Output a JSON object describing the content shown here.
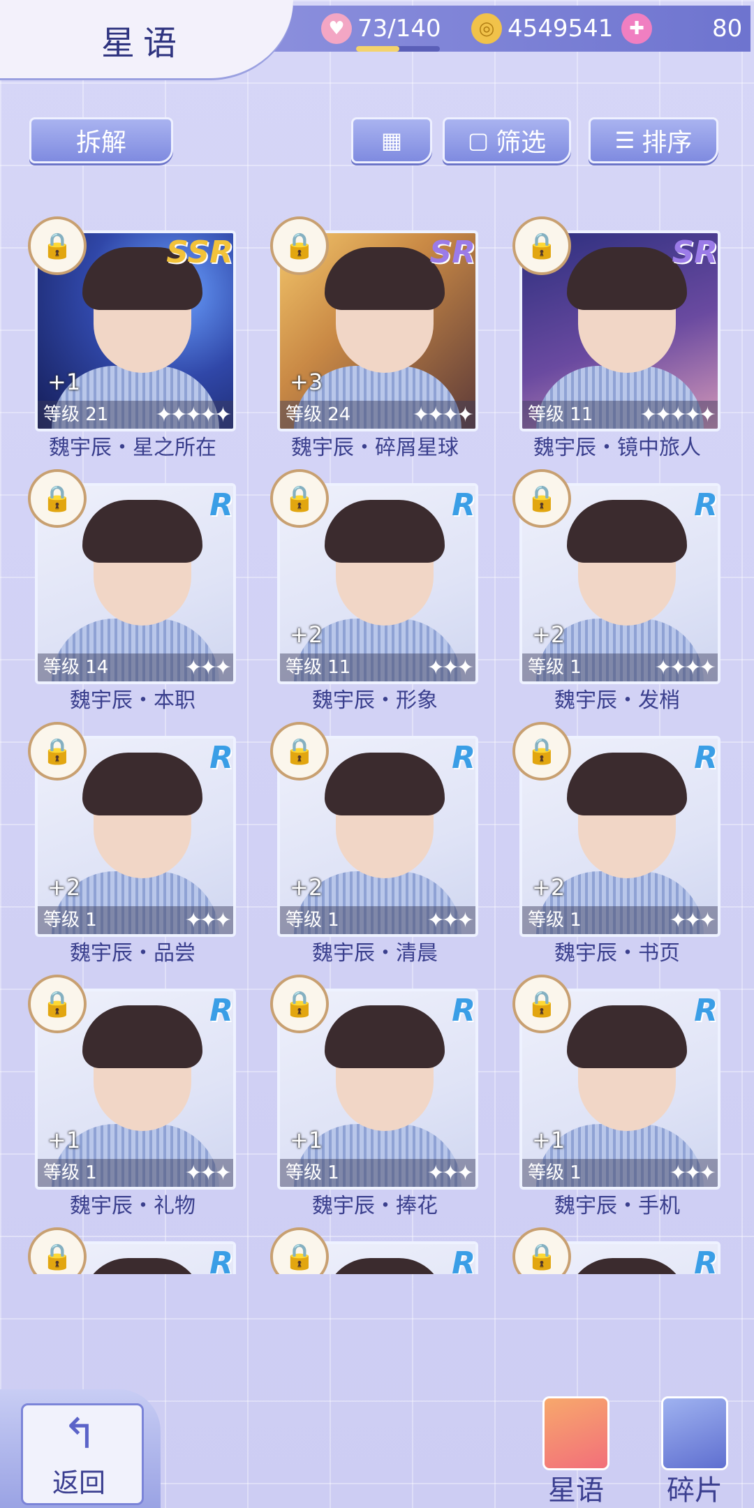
{
  "header": {
    "title": "星语",
    "stamina": "73/140",
    "stamina_fraction": 0.52,
    "coins": "4549541",
    "diamonds": "80",
    "icons": [
      "cupcake-stamina-icon",
      "gold-coin-icon",
      "pink-swan-diamond-icon"
    ]
  },
  "toolbar": {
    "decompose": "拆解",
    "grid_icon": "grid-view-icon",
    "filter": "筛选",
    "sort": "排序"
  },
  "cards": [
    {
      "name": "魏宇辰・星之所在",
      "level": "等级 21",
      "plus": "+1",
      "rarity": "SSR",
      "stars": "✦✦✦✦✦"
    },
    {
      "name": "魏宇辰・碎屑星球",
      "level": "等级 24",
      "plus": "+3",
      "rarity": "SR",
      "stars": "✦✦✦✦"
    },
    {
      "name": "魏宇辰・镜中旅人",
      "level": "等级 11",
      "plus": "",
      "rarity": "SR",
      "stars": "✦✦✦✦✦"
    },
    {
      "name": "魏宇辰・本职",
      "level": "等级 14",
      "plus": "",
      "rarity": "R",
      "stars": "✦✦✦"
    },
    {
      "name": "魏宇辰・形象",
      "level": "等级 11",
      "plus": "+2",
      "rarity": "R",
      "stars": "✦✦✦"
    },
    {
      "name": "魏宇辰・发梢",
      "level": "等级 1",
      "plus": "+2",
      "rarity": "R",
      "stars": "✦✦✦✦"
    },
    {
      "name": "魏宇辰・品尝",
      "level": "等级 1",
      "plus": "+2",
      "rarity": "R",
      "stars": "✦✦✦"
    },
    {
      "name": "魏宇辰・清晨",
      "level": "等级 1",
      "plus": "+2",
      "rarity": "R",
      "stars": "✦✦✦"
    },
    {
      "name": "魏宇辰・书页",
      "level": "等级 1",
      "plus": "+2",
      "rarity": "R",
      "stars": "✦✦✦"
    },
    {
      "name": "魏宇辰・礼物",
      "level": "等级 1",
      "plus": "+1",
      "rarity": "R",
      "stars": "✦✦✦"
    },
    {
      "name": "魏宇辰・捧花",
      "level": "等级 1",
      "plus": "+1",
      "rarity": "R",
      "stars": "✦✦✦"
    },
    {
      "name": "魏宇辰・手机",
      "level": "等级 1",
      "plus": "+1",
      "rarity": "R",
      "stars": "✦✦✦"
    },
    {
      "name": "",
      "level": "",
      "plus": "",
      "rarity": "R",
      "stars": ""
    },
    {
      "name": "",
      "level": "",
      "plus": "",
      "rarity": "R",
      "stars": ""
    },
    {
      "name": "",
      "level": "",
      "plus": "",
      "rarity": "R",
      "stars": ""
    }
  ],
  "bottom": {
    "back": "返回",
    "tab_cards": "星语",
    "tab_fragments": "碎片"
  }
}
